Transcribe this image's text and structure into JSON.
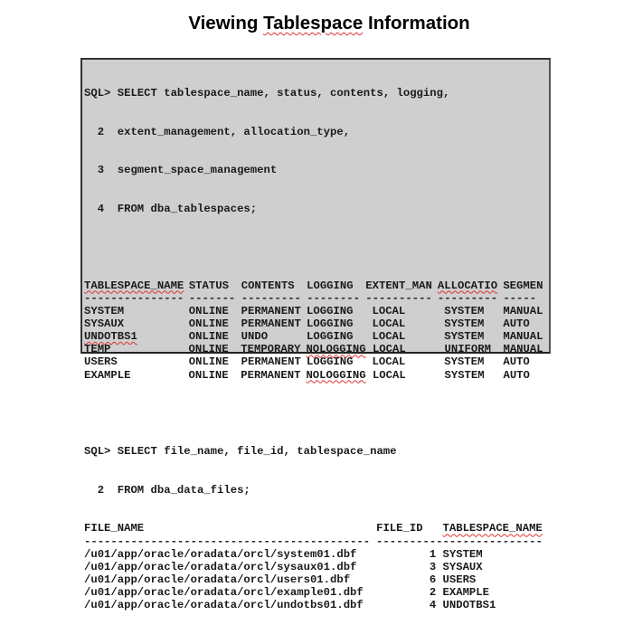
{
  "title": {
    "pre": "Viewing ",
    "word": "Tablespace",
    "post": " Information"
  },
  "query1": [
    "SQL> SELECT tablespace_name, status, contents, logging,",
    "  2  extent_management, allocation_type,",
    "  3  segment_space_management",
    "  4  FROM dba_tablespaces;"
  ],
  "table1": {
    "headers": [
      "TABLESPACE_NAME",
      "STATUS",
      "CONTENTS",
      "LOGGING",
      "EXTENT_MAN",
      "ALLOCATIO",
      "SEGMEN"
    ],
    "dashes": [
      "---------------",
      "-------",
      "---------",
      "--------",
      "----------",
      "---------",
      "-----"
    ],
    "rows": [
      [
        "SYSTEM",
        "ONLINE",
        "PERMANENT",
        "LOGGING",
        "LOCAL",
        "SYSTEM",
        "MANUAL"
      ],
      [
        "SYSAUX",
        "ONLINE",
        "PERMANENT",
        "LOGGING",
        "LOCAL",
        "SYSTEM",
        "AUTO"
      ],
      [
        "UNDOTBS1",
        "ONLINE",
        "UNDO",
        "LOGGING",
        "LOCAL",
        "SYSTEM",
        "MANUAL"
      ],
      [
        "TEMP",
        "ONLINE",
        "TEMPORARY",
        "NOLOGGING",
        "LOCAL",
        "UNIFORM",
        "MANUAL"
      ],
      [
        "USERS",
        "ONLINE",
        "PERMANENT",
        "LOGGING",
        "LOCAL",
        "SYSTEM",
        "AUTO"
      ],
      [
        "EXAMPLE",
        "ONLINE",
        "PERMANENT",
        "NOLOGGING",
        "LOCAL",
        "SYSTEM",
        "AUTO"
      ]
    ]
  },
  "query2": [
    "SQL> SELECT file_name, file_id, tablespace_name",
    "  2  FROM dba_data_files;"
  ],
  "table2": {
    "headers": [
      "FILE_NAME",
      "FILE_ID",
      "TABLESPACE_NAME"
    ],
    "dashes": [
      "-------------------------------------------",
      "----------",
      "---------------"
    ],
    "rows": [
      [
        "/u01/app/oracle/oradata/orcl/system01.dbf",
        "1",
        "SYSTEM"
      ],
      [
        "/u01/app/oracle/oradata/orcl/sysaux01.dbf",
        "3",
        "SYSAUX"
      ],
      [
        "/u01/app/oracle/oradata/orcl/users01.dbf",
        "6",
        "USERS"
      ],
      [
        "/u01/app/oracle/oradata/orcl/example01.dbf",
        "2",
        "EXAMPLE"
      ],
      [
        "/u01/app/oracle/oradata/orcl/undotbs01.dbf",
        "4",
        "UNDOTBS1"
      ]
    ]
  }
}
